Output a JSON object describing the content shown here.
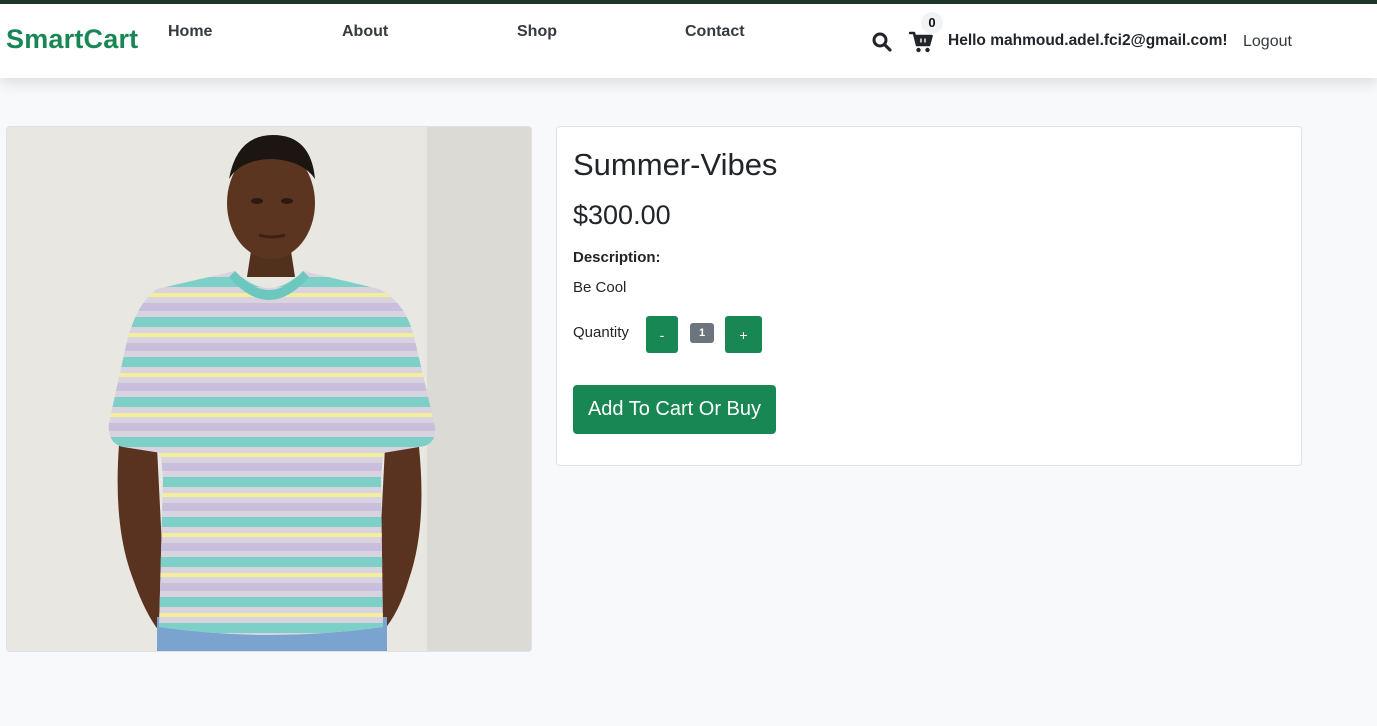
{
  "brand": {
    "name": "SmartCart",
    "color": "#198754"
  },
  "nav": {
    "links": [
      {
        "label": "Home"
      },
      {
        "label": "About"
      },
      {
        "label": "Shop"
      },
      {
        "label": "Contact"
      }
    ],
    "search_icon": "search-icon",
    "cart_icon": "cart-icon",
    "cart_count": "0",
    "greeting": "Hello mahmoud.adel.fci2@gmail.com!",
    "logout_label": "Logout"
  },
  "product": {
    "image_alt": "Man wearing striped summer t-shirt",
    "title": "Summer-Vibes",
    "price": "$300.00",
    "description_label": "Description:",
    "description": "Be Cool",
    "quantity_label": "Quantity",
    "decrement_label": "-",
    "quantity": "1",
    "increment_label": "+",
    "add_button_label": "Add To Cart Or Buy"
  },
  "colors": {
    "accent": "#198754",
    "top_border": "#20362b",
    "badge_gray": "#6c757d",
    "page_bg": "#f8f9fa"
  }
}
